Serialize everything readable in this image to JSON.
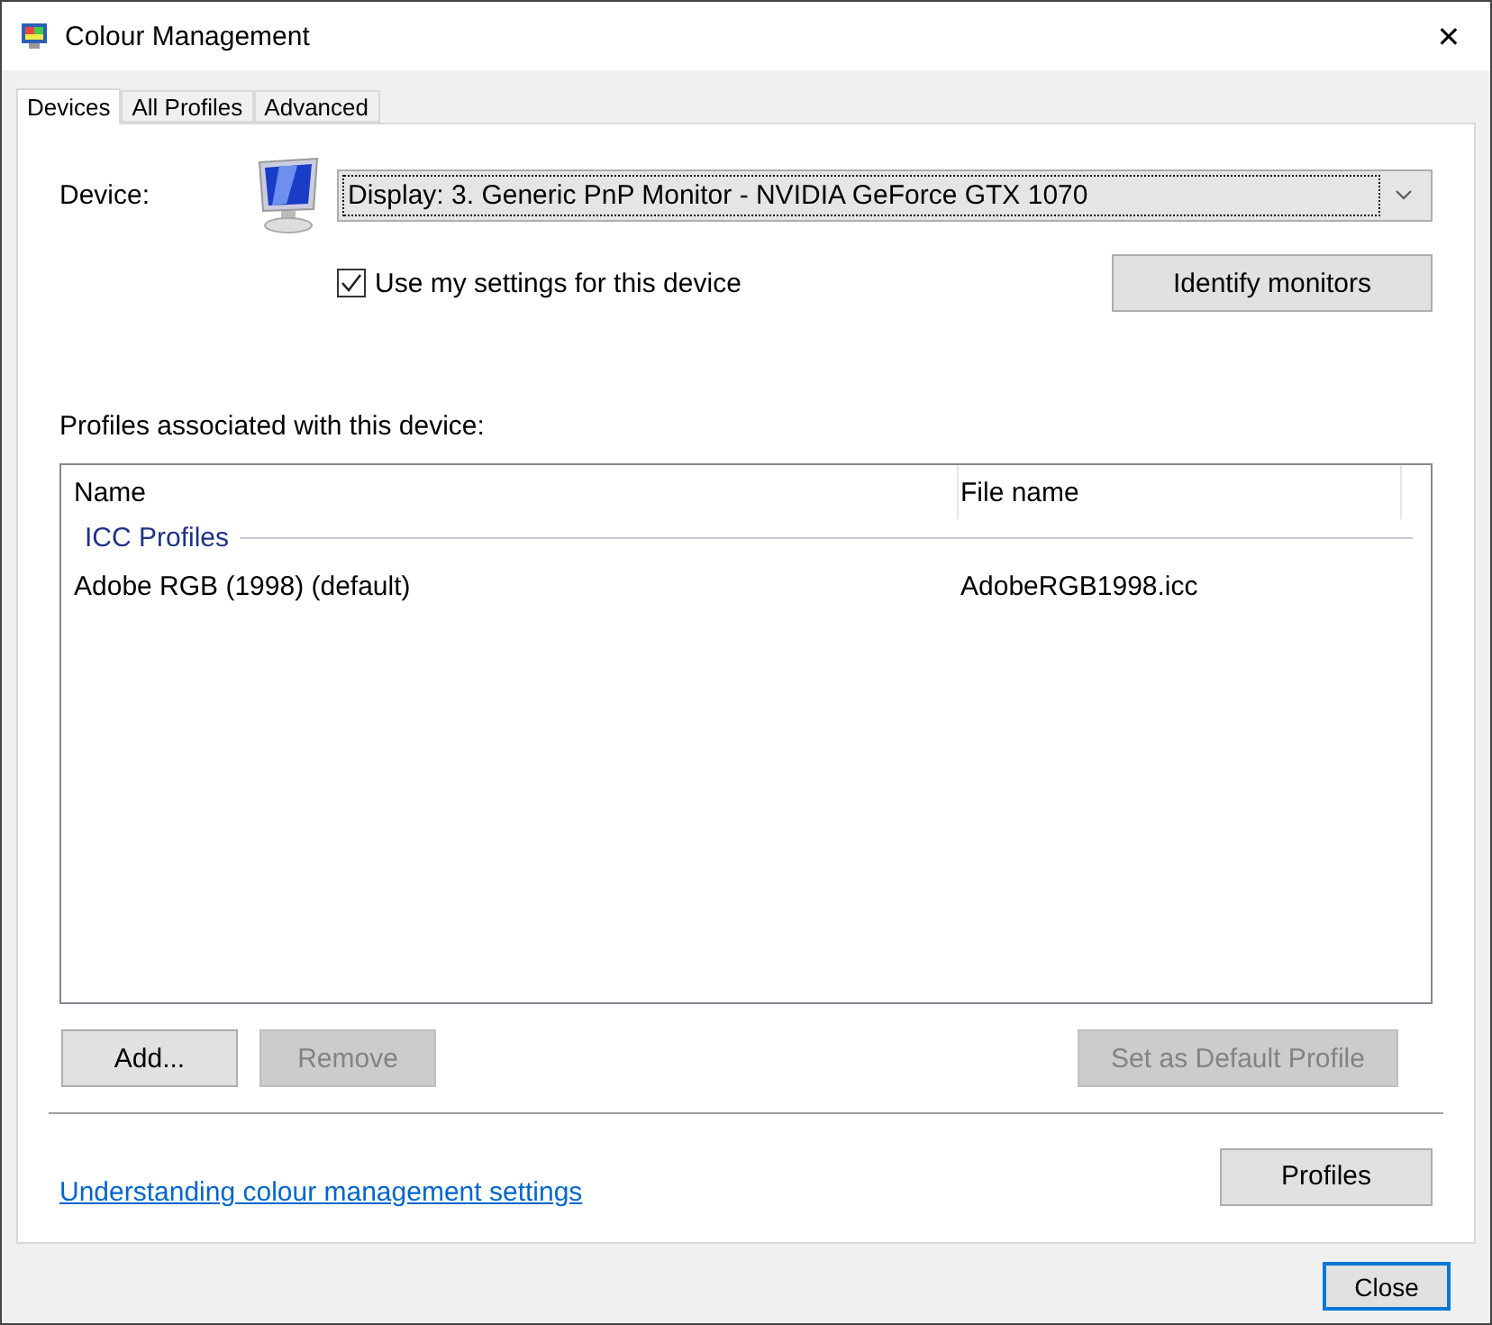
{
  "window": {
    "title": "Colour Management",
    "close": "✕"
  },
  "tabs": [
    {
      "label": "Devices",
      "selected": true
    },
    {
      "label": "All Profiles",
      "selected": false
    },
    {
      "label": "Advanced",
      "selected": false
    }
  ],
  "device": {
    "label": "Device:",
    "value": "Display: 3. Generic PnP Monitor - NVIDIA GeForce GTX 1070"
  },
  "use_my_settings": {
    "label": "Use my settings for this device",
    "checked": true
  },
  "identify_button": "Identify monitors",
  "profiles_label": "Profiles associated with this device:",
  "table": {
    "columns": [
      "Name",
      "File name"
    ],
    "groups": [
      {
        "title": "ICC Profiles",
        "rows": [
          {
            "name": "Adobe RGB (1998) (default)",
            "file": "AdobeRGB1998.icc"
          }
        ]
      }
    ]
  },
  "actions": [
    {
      "label": "Add...",
      "disabled": false
    },
    {
      "label": "Remove",
      "disabled": true
    },
    {
      "label": "Set as Default Profile",
      "disabled": true
    }
  ],
  "help_link": "Understanding colour management settings",
  "profiles_button": "Profiles",
  "close_button": "Close"
}
